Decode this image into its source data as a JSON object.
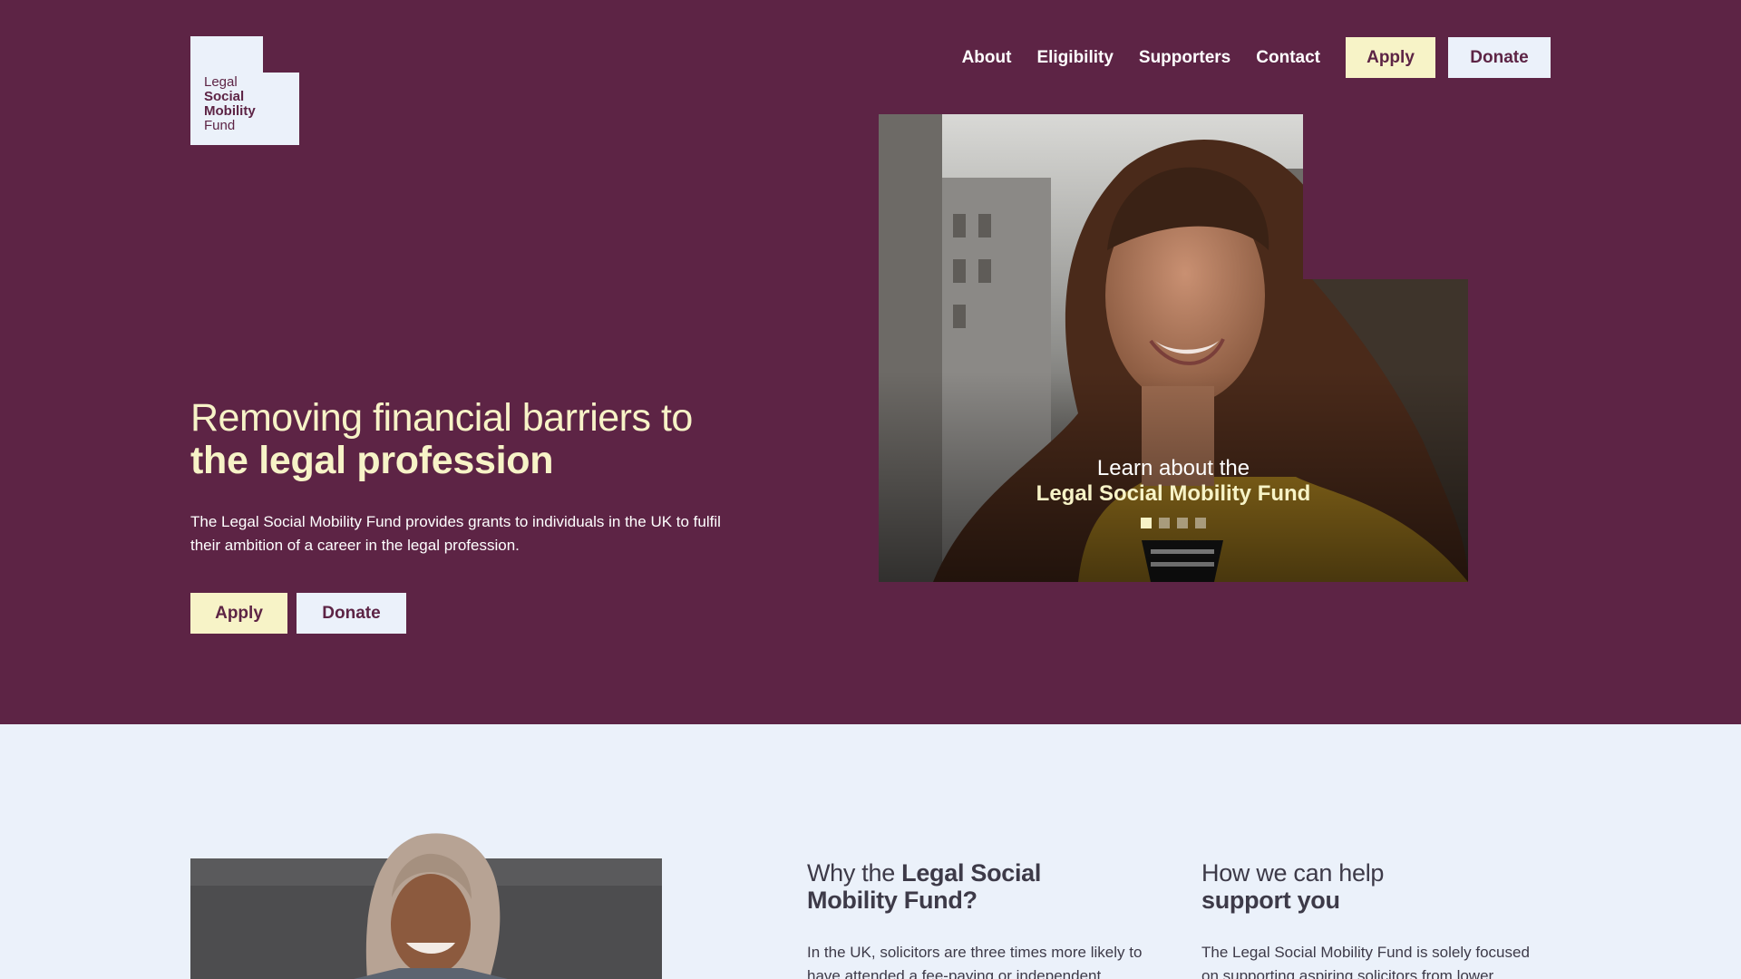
{
  "colors": {
    "brand": "#5d2445",
    "cream": "#f7f3c7",
    "pale": "#ebf1fa"
  },
  "logo": {
    "line1": "Legal",
    "line2": "Social",
    "line3": "Mobility",
    "line4": "Fund"
  },
  "nav": {
    "links": [
      "About",
      "Eligibility",
      "Supporters",
      "Contact"
    ],
    "apply_label": "Apply",
    "donate_label": "Donate"
  },
  "hero": {
    "headline_light": "Removing financial barriers to",
    "headline_bold": "the legal profession",
    "intro": "The Legal Social Mobility Fund provides grants to individuals in the UK to fulfil their ambition of a career in the legal profession.",
    "apply_label": "Apply",
    "donate_label": "Donate"
  },
  "carousel": {
    "caption_line1": "Learn about the",
    "caption_line2": "Legal Social Mobility Fund",
    "slide_count": 4,
    "active_slide": 1
  },
  "why": {
    "heading_light": "Why the ",
    "heading_bold_1": "Legal Social",
    "heading_bold_2": "Mobility Fund?",
    "body": "In the UK, solicitors are three times more likely to have attended a fee-paying or independent"
  },
  "help": {
    "heading_light": "How we can help",
    "heading_bold": "support you",
    "body": "The Legal Social Mobility Fund is solely focused on supporting aspiring solicitors from lower"
  }
}
